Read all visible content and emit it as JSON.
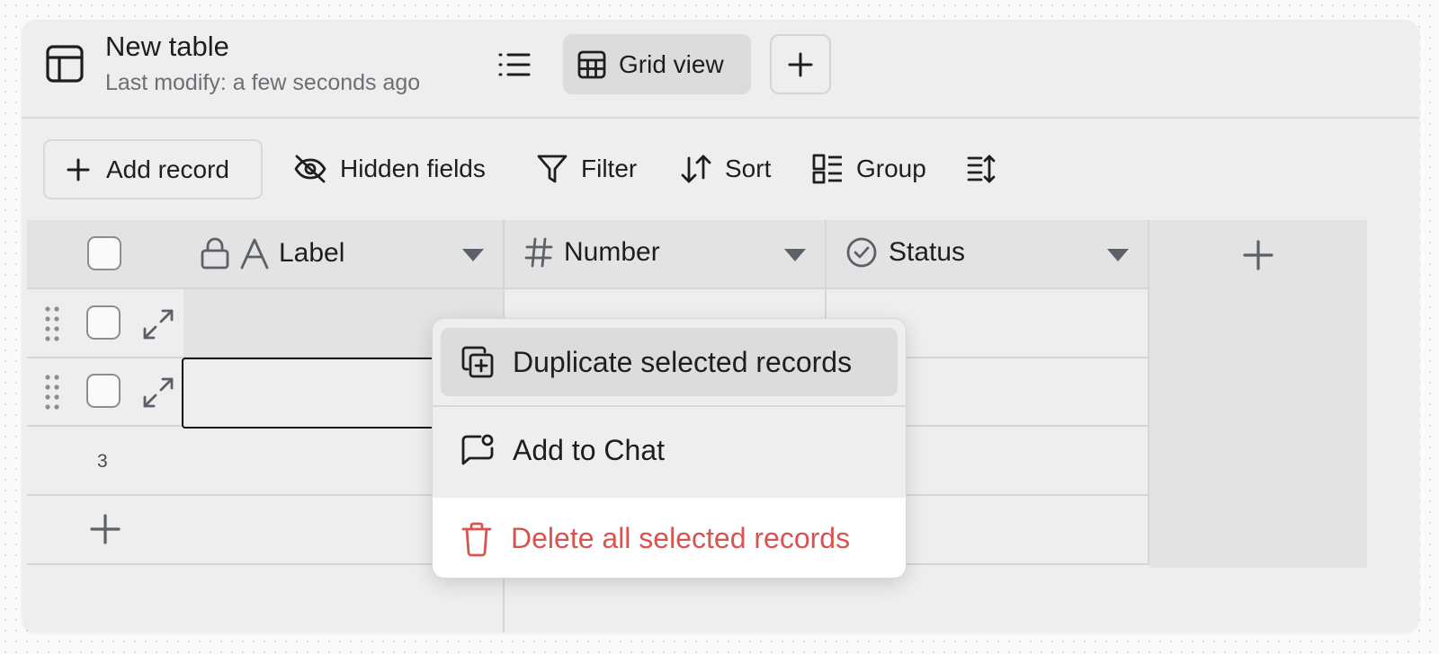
{
  "header": {
    "title": "New table",
    "subtitle": "Last modify: a few seconds ago",
    "view_tab_label": "Grid view",
    "icons": [
      "table-icon",
      "list-icon",
      "grid-view-icon",
      "plus-icon"
    ]
  },
  "toolbar": {
    "add_record": "Add record",
    "hidden_fields": "Hidden fields",
    "filter": "Filter",
    "sort": "Sort",
    "group": "Group",
    "icons": [
      "plus-icon",
      "eye-off-icon",
      "filter-icon",
      "sort-icon",
      "group-icon",
      "row-height-icon"
    ]
  },
  "grid": {
    "columns": [
      {
        "title": "Label",
        "icon": "text-field-icon",
        "locked": true
      },
      {
        "title": "Number",
        "icon": "hash-icon"
      },
      {
        "title": "Status",
        "icon": "check-circle-icon"
      }
    ],
    "rows": [
      {
        "number": "",
        "label": "",
        "checked": false
      },
      {
        "number": "",
        "label": "",
        "checked": false,
        "editing": true
      },
      {
        "number": "3",
        "label": ""
      }
    ]
  },
  "context_menu": {
    "items": [
      {
        "label": "Duplicate selected records",
        "icon": "duplicate-icon",
        "highlighted": true
      },
      {
        "label": "Add to Chat",
        "icon": "chat-add-icon"
      },
      {
        "label": "Delete all selected records",
        "icon": "trash-icon",
        "danger": true
      }
    ]
  },
  "colors": {
    "background": "#eeeeee",
    "header_row": "#e3e3e3",
    "danger": "#d9534f",
    "icon": "#5c6068"
  }
}
